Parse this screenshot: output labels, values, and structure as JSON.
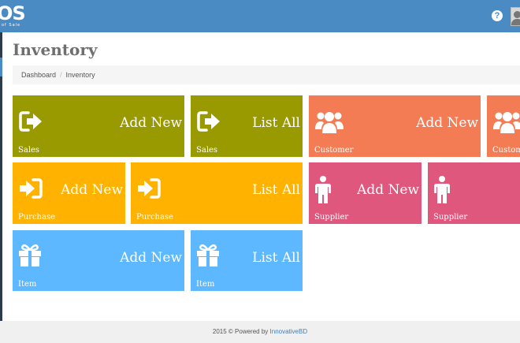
{
  "header": {
    "logo_text": "OS",
    "logo_sub": "of Sale",
    "help_icon": "question-circle-icon",
    "avatar_icon": "user-avatar-icon"
  },
  "page": {
    "title": "Inventory"
  },
  "breadcrumb": {
    "home": "Dashboard",
    "separator": "/",
    "current": "Inventory"
  },
  "tiles": {
    "sales_add": {
      "action": "Add New",
      "caption": "Sales",
      "icon": "sign-out-icon",
      "color": "#999900"
    },
    "sales_list": {
      "action": "List All",
      "caption": "Sales",
      "icon": "sign-out-icon",
      "color": "#999900"
    },
    "customer_add": {
      "action": "Add New",
      "caption": "Customer",
      "icon": "users-icon",
      "color": "#f47c55"
    },
    "customer_list": {
      "action": "",
      "caption": "Custom",
      "icon": "users-icon",
      "color": "#f47c55"
    },
    "purchase_add": {
      "action": "Add New",
      "caption": "Purchase",
      "icon": "sign-in-icon",
      "color": "#ffb300"
    },
    "purchase_list": {
      "action": "List All",
      "caption": "Purchase",
      "icon": "sign-in-icon",
      "color": "#ffb300"
    },
    "supplier_add": {
      "action": "Add New",
      "caption": "Supplier",
      "icon": "male-icon",
      "color": "#e0577e"
    },
    "supplier_list": {
      "action": "",
      "caption": "Supplier",
      "icon": "male-icon",
      "color": "#e0577e"
    },
    "item_add": {
      "action": "Add New",
      "caption": "Item",
      "icon": "gift-icon",
      "color": "#5db8ff"
    },
    "item_list": {
      "action": "List All",
      "caption": "Item",
      "icon": "gift-icon",
      "color": "#5db8ff"
    }
  },
  "footer": {
    "text": "2015 © Powered by",
    "link": "InnovativeBD"
  }
}
